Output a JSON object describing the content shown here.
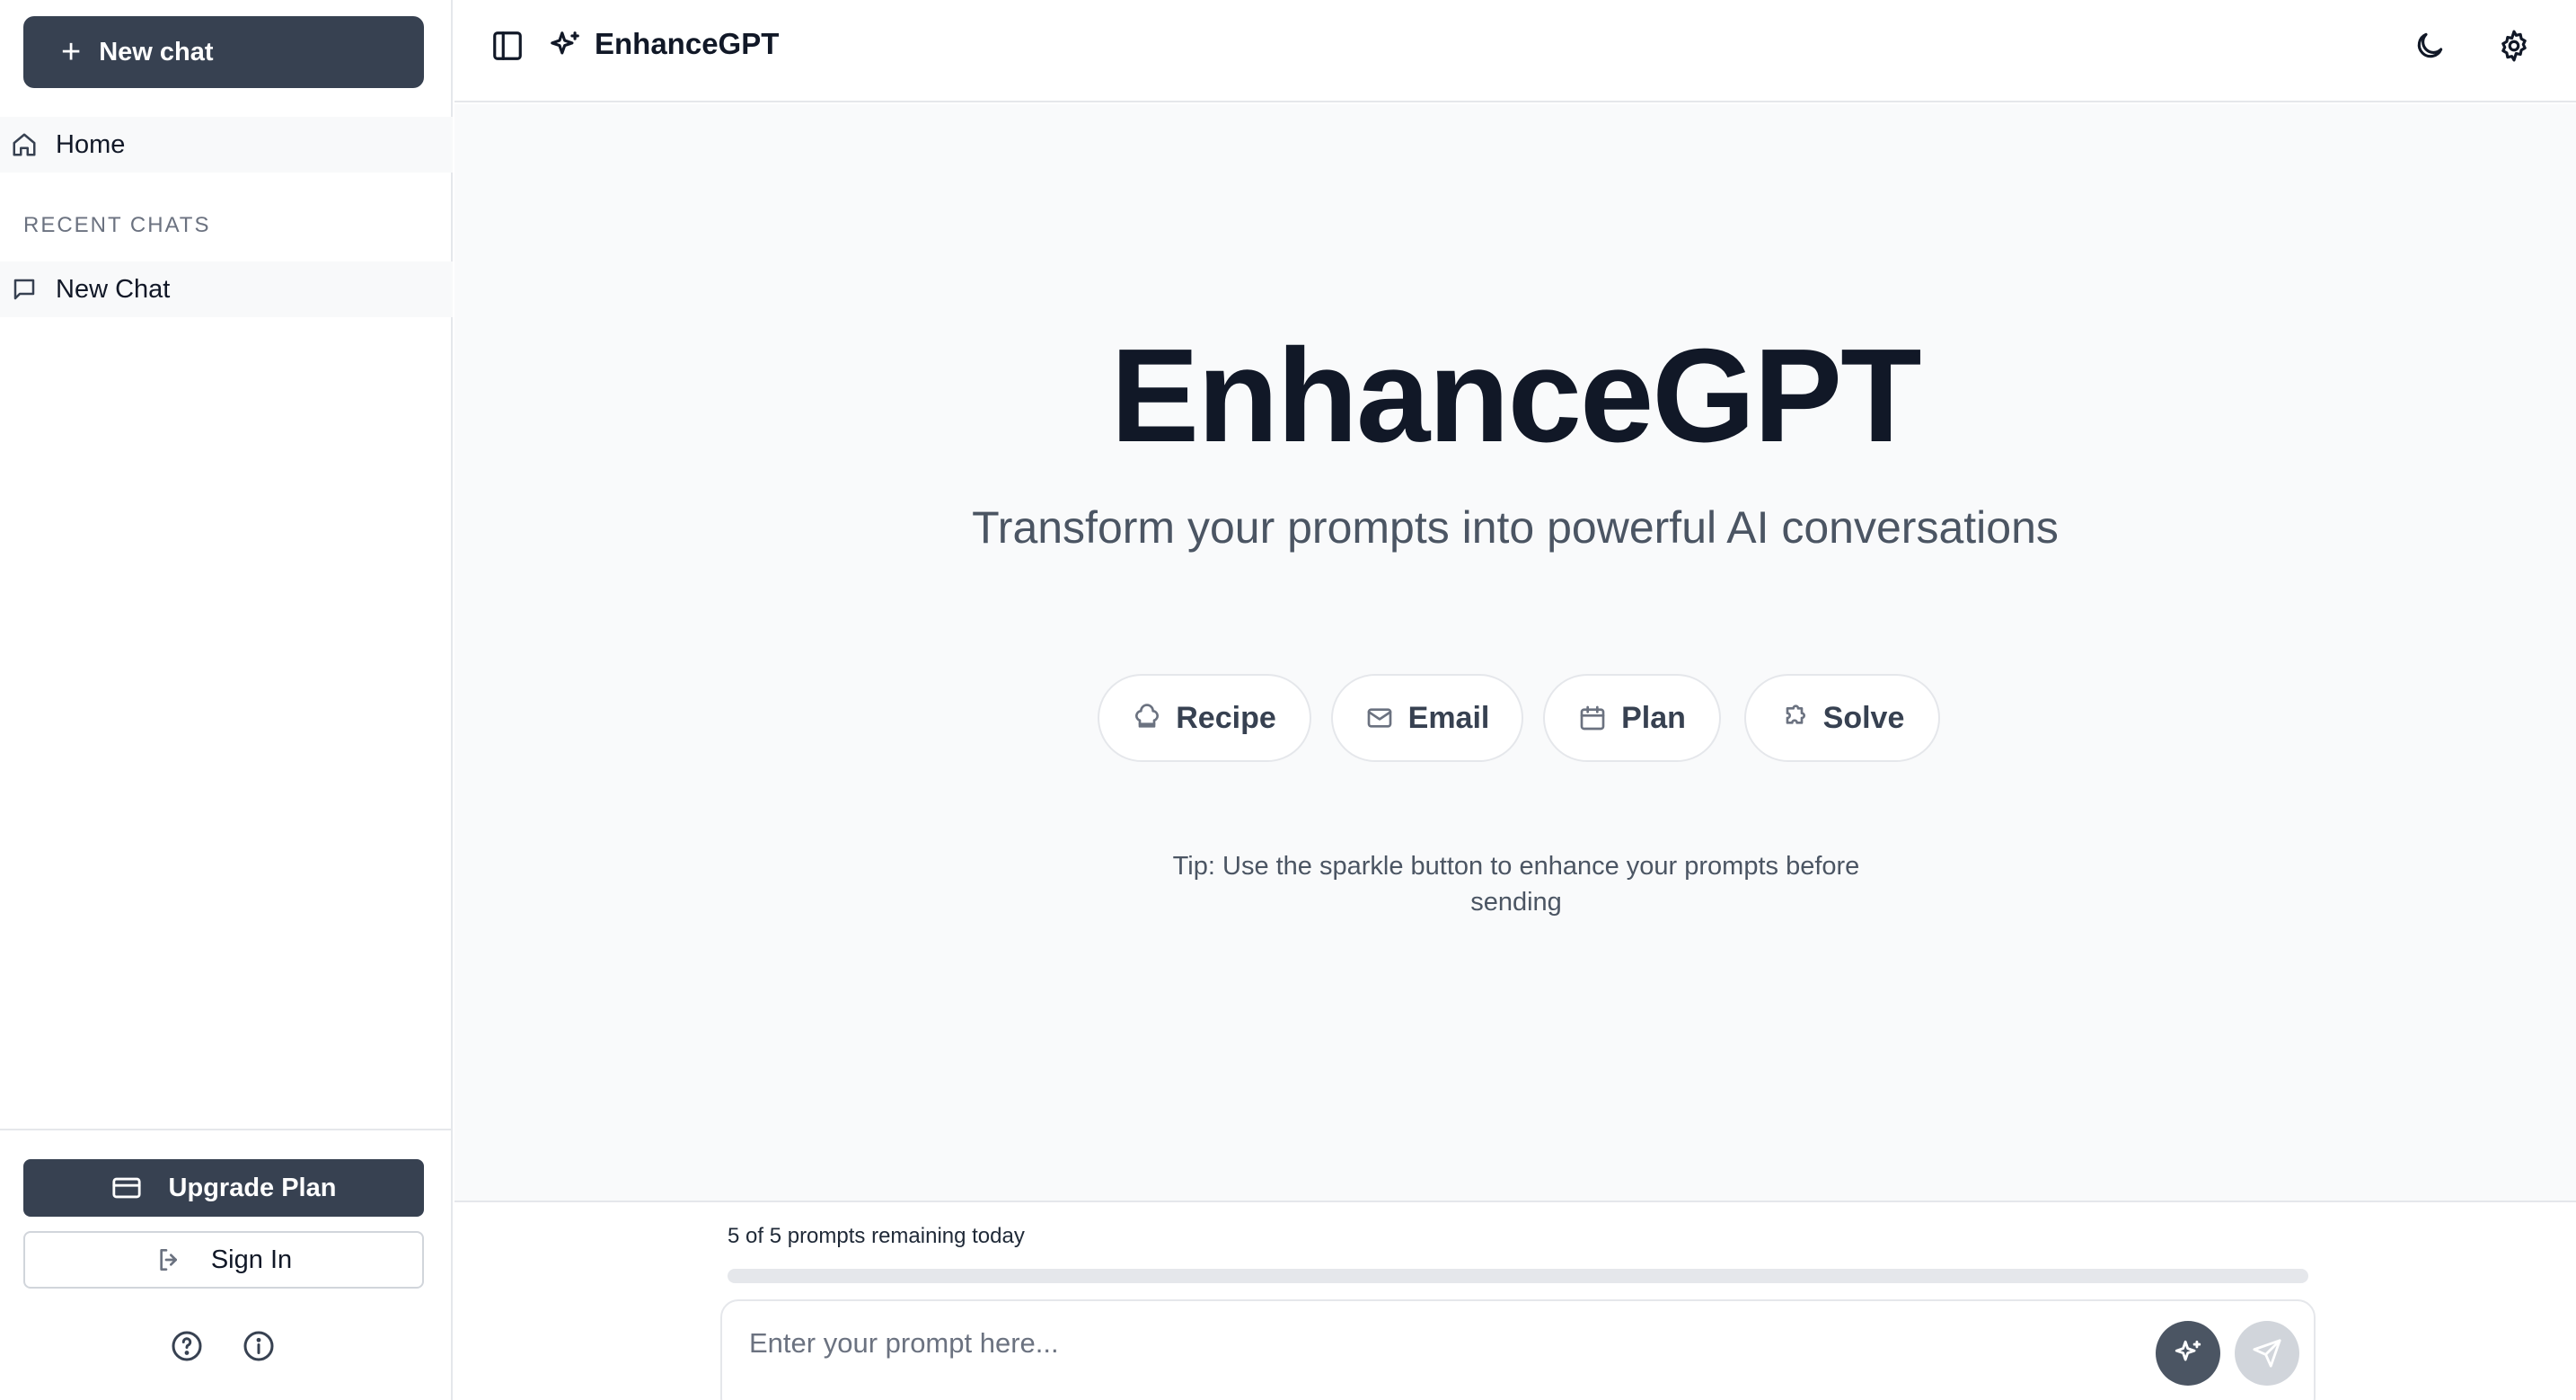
{
  "sidebar": {
    "new_chat_label": "New chat",
    "home_label": "Home",
    "section_title": "RECENT CHATS",
    "recent_chats": [
      {
        "label": "New Chat"
      }
    ],
    "upgrade_label": "Upgrade Plan",
    "signin_label": "Sign In",
    "footer_icons": [
      "help-circle-icon",
      "info-icon"
    ]
  },
  "header": {
    "title": "EnhanceGPT",
    "icons": [
      "sidebar-toggle-icon",
      "sparkles-icon",
      "moon-icon",
      "gear-icon"
    ]
  },
  "hero": {
    "title": "EnhanceGPT",
    "subtitle": "Transform your prompts into powerful AI conversations",
    "chips": [
      {
        "label": "Recipe",
        "icon": "chef-hat-icon"
      },
      {
        "label": "Email",
        "icon": "mail-icon"
      },
      {
        "label": "Plan",
        "icon": "calendar-icon"
      },
      {
        "label": "Solve",
        "icon": "puzzle-icon"
      }
    ],
    "tip": "Tip: Use the sparkle button to enhance your prompts before sending"
  },
  "composer": {
    "remaining_text": "5 of 5 prompts remaining today",
    "usage_fraction": 0,
    "placeholder": "Enter your prompt here...",
    "value": ""
  },
  "colors": {
    "primary_dark": "#374151",
    "text": "#111827",
    "muted": "#6b7280",
    "border": "#e5e7eb",
    "main_bg": "#f9fafb"
  }
}
